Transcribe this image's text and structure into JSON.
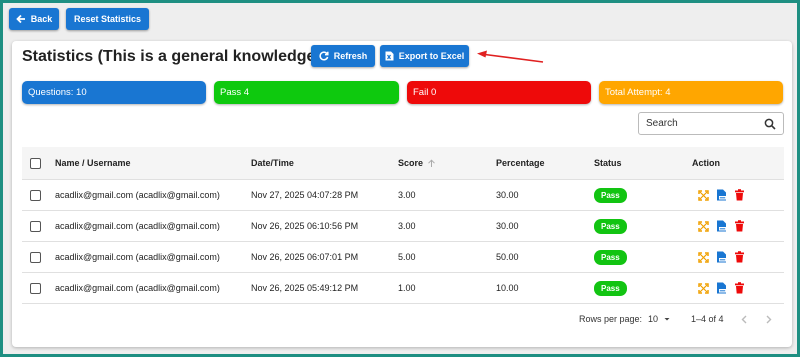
{
  "toolbar": {
    "back_label": "Back",
    "reset_label": "Reset Statistics"
  },
  "header": {
    "title": "Statistics (This is a general knowledge quiz)",
    "refresh_label": "Refresh",
    "export_label": "Export to Excel"
  },
  "stats": {
    "questions": "Questions: 10",
    "pass": "Pass 4",
    "fail": "Fail 0",
    "attempts": "Total Attempt: 4"
  },
  "colors": {
    "primary": "#1976d2",
    "questions": "#1976d2",
    "pass": "#0ec90e",
    "fail": "#ee0a0a",
    "attempts": "#ffa600",
    "annotation": "#e02020"
  },
  "search": {
    "placeholder": "Search"
  },
  "table": {
    "columns": [
      "Name / Username",
      "Date/Time",
      "Score",
      "Percentage",
      "Status",
      "Action"
    ],
    "rows": [
      {
        "name": "acadlix@gmail.com (acadlix@gmail.com)",
        "datetime": "Nov 27, 2025 04:07:28 PM",
        "score": "3.00",
        "percentage": "30.00",
        "status": "Pass"
      },
      {
        "name": "acadlix@gmail.com (acadlix@gmail.com)",
        "datetime": "Nov 26, 2025 06:10:56 PM",
        "score": "3.00",
        "percentage": "30.00",
        "status": "Pass"
      },
      {
        "name": "acadlix@gmail.com (acadlix@gmail.com)",
        "datetime": "Nov 26, 2025 06:07:01 PM",
        "score": "5.00",
        "percentage": "50.00",
        "status": "Pass"
      },
      {
        "name": "acadlix@gmail.com (acadlix@gmail.com)",
        "datetime": "Nov 26, 2025 05:49:12 PM",
        "score": "1.00",
        "percentage": "10.00",
        "status": "Pass"
      }
    ],
    "action_icons": [
      "expand-icon",
      "pdf-icon",
      "delete-icon"
    ]
  },
  "pagination": {
    "rows_per_page_label": "Rows per page:",
    "rows_per_page": "10",
    "range": "1–4 of 4"
  }
}
